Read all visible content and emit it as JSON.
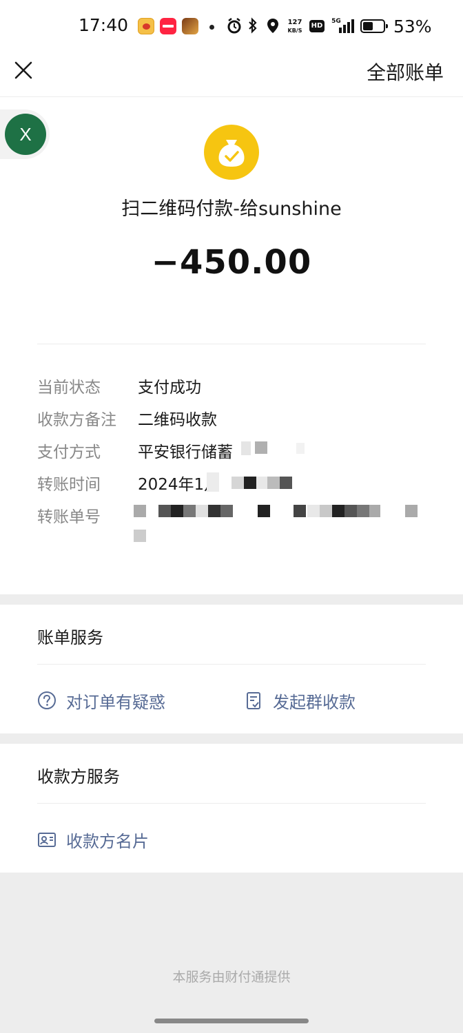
{
  "status_bar": {
    "time": "17:40",
    "net_speed_top": "127",
    "net_speed_unit": "KB/S",
    "hd": "HD",
    "network": "5G",
    "battery_percent": "53%",
    "battery_level": 0.53
  },
  "header": {
    "close_icon": "close-icon",
    "all_bills": "全部账单"
  },
  "floating": {
    "badge": "X"
  },
  "transaction": {
    "title": "扫二维码付款-给sunshine",
    "amount": "−450.00",
    "icon": "money-bag-check-icon",
    "accent_color": "#f6c511"
  },
  "details": [
    {
      "key": "当前状态",
      "value": "支付成功"
    },
    {
      "key": "收款方备注",
      "value": "二维码收款"
    },
    {
      "key": "支付方式",
      "value": "平安银行储蓄"
    },
    {
      "key": "转账时间",
      "value": "2024年1月"
    },
    {
      "key": "转账单号",
      "value": ""
    }
  ],
  "bill_services": {
    "title": "账单服务",
    "actions": [
      {
        "label": "对订单有疑惑",
        "icon": "question-circle-icon"
      },
      {
        "label": "发起群收款",
        "icon": "group-collect-icon"
      }
    ]
  },
  "payee_services": {
    "title": "收款方服务",
    "actions": [
      {
        "label": "收款方名片",
        "icon": "contact-card-icon"
      }
    ]
  },
  "footer": "本服务由财付通提供",
  "colors": {
    "link": "#576b95",
    "label": "#888888"
  }
}
